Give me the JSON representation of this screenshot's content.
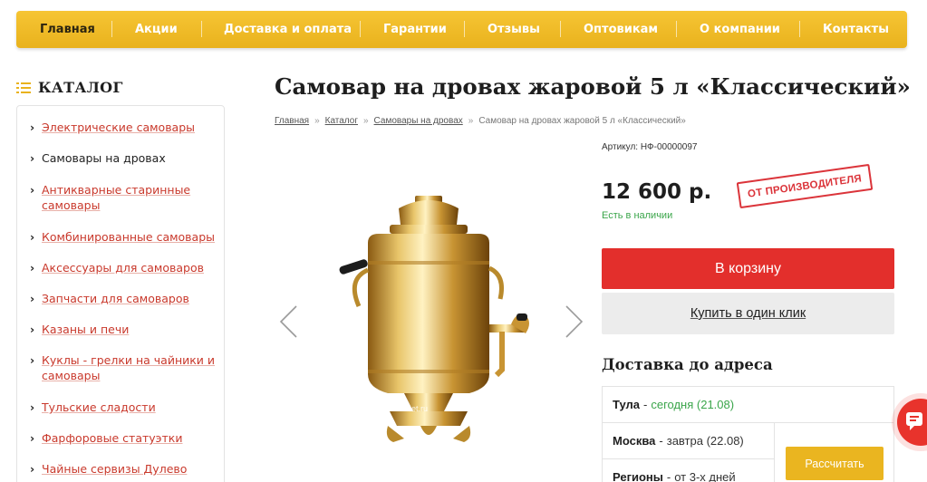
{
  "nav": {
    "items": [
      "Главная",
      "Акции",
      "Доставка и оплата",
      "Гарантии",
      "Отзывы",
      "Оптовикам",
      "О компании",
      "Контакты"
    ],
    "active_index": 0
  },
  "catalog": {
    "title": "КАТАЛОГ",
    "items": [
      "Электрические самовары",
      "Самовары на дровах",
      "Антикварные старинные самовары",
      "Комбинированные самовары",
      "Аксессуары для самоваров",
      "Запчасти для самоваров",
      "Казаны и печи",
      "Куклы - грелки на чайники и самовары",
      "Тульские сладости",
      "Фарфоровые статуэтки",
      "Чайные сервизы Дулево"
    ],
    "current_index": 1
  },
  "product": {
    "title": "Самовар на дровах жаровой 5 л «Классический»",
    "breadcrumb": [
      "Главная",
      "Каталог",
      "Самовары на дровах",
      "Самовар на дровах жаровой 5 л «Классический»"
    ],
    "breadcrumb_separator": "»",
    "sku": "Артикул: НФ-00000097",
    "price": "12 600 р.",
    "stock": "Есть в наличии",
    "stamp": "ОТ ПРОИЗВОДИТЕЛЯ",
    "watermark": "samovarov-net.ru"
  },
  "actions": {
    "cart": "В корзину",
    "one_click": "Купить в один клик",
    "calculate": "Рассчитать"
  },
  "delivery": {
    "title": "Доставка до адреса",
    "rows": [
      {
        "city": "Тула",
        "when": "сегодня (21.08)",
        "highlight": true
      },
      {
        "city": "Москва",
        "when": "завтра (22.08)",
        "highlight": false
      },
      {
        "city": "Регионы",
        "when": "от 3-х дней",
        "highlight": false
      }
    ],
    "dash": "-"
  },
  "icons": {
    "catalog": "list-icon",
    "prev": "chevron-left-icon",
    "next": "chevron-right-icon",
    "chat": "chat-icon",
    "breadcrumb_chevron": "›"
  },
  "colors": {
    "nav_bg": "#e9b21d",
    "cart_button": "#e32f2c",
    "calc_button": "#eab520",
    "link_red": "#c9392c",
    "in_stock_green": "#3aa54a",
    "stamp_red": "#d8232a"
  }
}
